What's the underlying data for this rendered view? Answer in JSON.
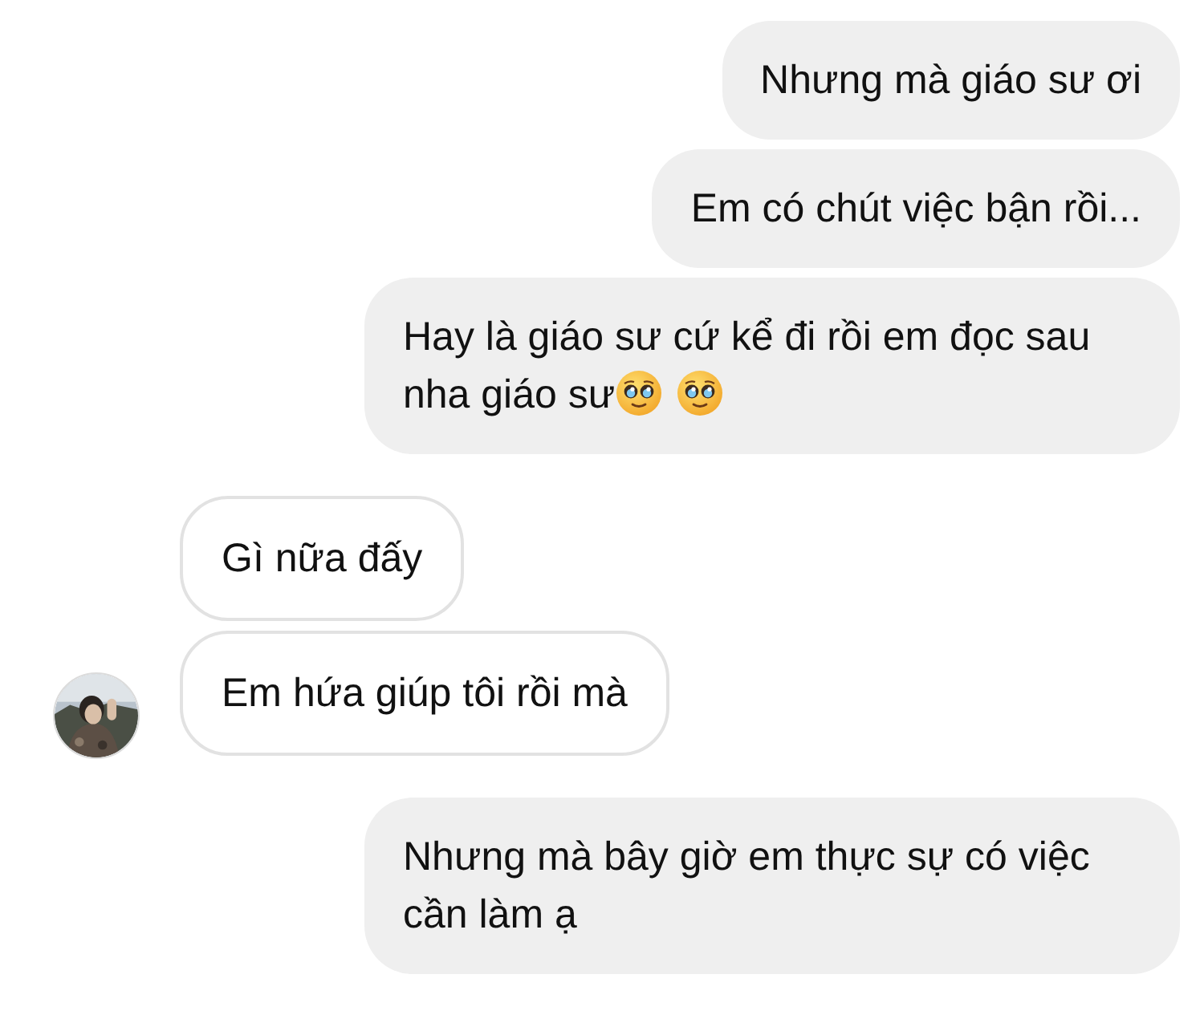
{
  "messages": [
    {
      "kind": "sent",
      "text": "Nhưng mà giáo sư ơi"
    },
    {
      "kind": "sent",
      "text": "Em có chút việc bận rồi..."
    },
    {
      "kind": "sent",
      "text": "Hay là giáo sư cứ kể đi rồi em đọc sau nha giáo sư",
      "emoji": [
        {
          "kind": "pleading"
        },
        {
          "kind": "pleading"
        }
      ]
    },
    {
      "kind": "received",
      "text": "Gì nữa đấy"
    },
    {
      "kind": "received",
      "text": "Em hứa giúp tôi rồi mà"
    },
    {
      "kind": "sent",
      "text": "Nhưng mà bây giờ em thực sự có việc cần làm ạ"
    }
  ]
}
